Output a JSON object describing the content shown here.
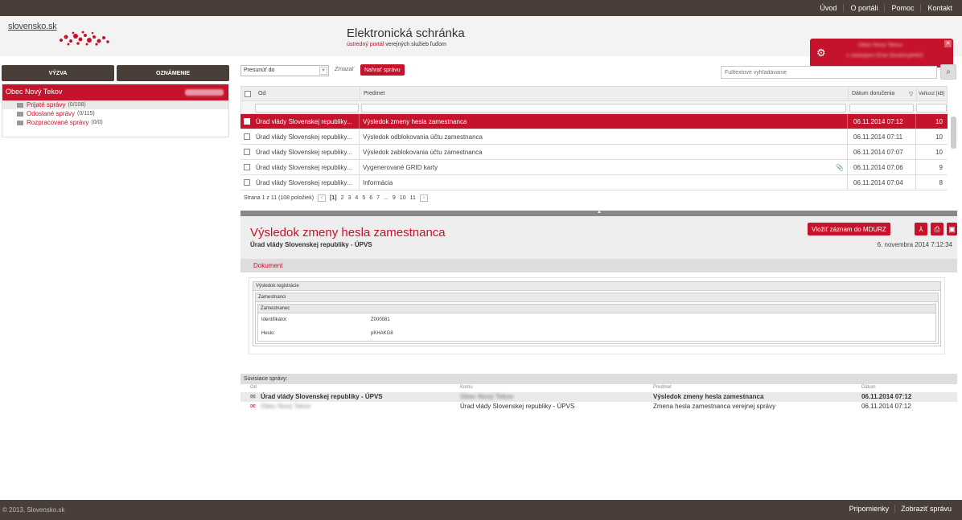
{
  "topnav": [
    "Úvod",
    "O portáli",
    "Pomoc",
    "Kontakt"
  ],
  "header": {
    "logo": "slovensko.sk",
    "title": "Elektronická schránka",
    "subtitle_red": "ústredný portál",
    "subtitle_dark": "verejných služieb ľuďom",
    "user_line1": "Obec Nový Tekov",
    "user_line2": "v zastúpení Emil Skuteľný#402"
  },
  "left": {
    "tab_challenge": "VÝZVA",
    "tab_notice": "OZNÁMENIE",
    "account": "Obec Nový Tekov",
    "folders": [
      {
        "label": "Prijaté správy",
        "count": "(0/108)"
      },
      {
        "label": "Odoslané správy",
        "count": "(0/115)"
      },
      {
        "label": "Rozpracované správy",
        "count": "(0/0)"
      }
    ]
  },
  "toolbar": {
    "move_value": "Presunúť do",
    "delete_label": "Zmazať",
    "load_label": "Nahrať správu",
    "search_placeholder": "Fulltextové vyhľadávanie"
  },
  "grid": {
    "columns": {
      "from": "Od",
      "subject": "Predmet",
      "date": "Dátum doručenia",
      "size": "Veľkosť [kB]"
    },
    "rows": [
      {
        "from": "Úrad vlády Slovenskej republiky...",
        "subject": "Výsledok zmeny hesla zamestnanca",
        "date": "06.11.2014 07:12",
        "size": "10"
      },
      {
        "from": "Úrad vlády Slovenskej republiky...",
        "subject": "Výsledok odblokovania účtu zamestnanca",
        "date": "06.11.2014 07:11",
        "size": "10"
      },
      {
        "from": "Úrad vlády Slovenskej republiky...",
        "subject": "Výsledok zablokovania účtu zamestnanca",
        "date": "06.11.2014 07:07",
        "size": "10"
      },
      {
        "from": "Úrad vlády Slovenskej republiky...",
        "subject": "Vygenerované GRID karty",
        "date": "06.11.2014 07:06",
        "size": "9"
      },
      {
        "from": "Úrad vlády Slovenskej republiky...",
        "subject": "Informácia",
        "date": "06.11.2014 07:04",
        "size": "8"
      }
    ]
  },
  "pager": {
    "summary": "Strana 1 z 11 (108 položiek)",
    "pages": [
      "[1]",
      "2",
      "3",
      "4",
      "5",
      "6",
      "7",
      "...",
      "9",
      "10",
      "11"
    ]
  },
  "detail": {
    "title": "Výsledok zmeny hesla zamestnanca",
    "from": "Úrad vlády Slovenskej republiky - ÚPVS",
    "date": "6. novembra 2014 7:12:34",
    "mdurz_label": "Vložiť záznam do MDURZ",
    "tab": "Dokument",
    "doc": {
      "section1": "Výsledok registrácie",
      "section2": "Zamestnanci",
      "section3": "Zamestnanec",
      "id_label": "Identifikátor:",
      "id_value": "Z000081",
      "pwd_label": "Heslo:",
      "pwd_value": "pKHAKG8"
    }
  },
  "related": {
    "title": "Súvisiace správy:",
    "cols": {
      "from": "Od",
      "to": "Komu",
      "subject": "Predmet",
      "date": "Dátum"
    },
    "rows": [
      {
        "from": "Úrad vlády Slovenskej republiky - ÚPVS",
        "to": "Obec Nový Tekov",
        "subject": "Výsledok zmeny hesla zamestnanca",
        "date": "06.11.2014 07:12"
      },
      {
        "from": "Obec Nový Tekov",
        "to": "Úrad vlády Slovenskej republiky - ÚPVS",
        "subject": "Zmena hesla zamestnanca verejnej správy",
        "date": "06.11.2014 07:12"
      }
    ]
  },
  "footer": {
    "copyright": "© 2013, Slovensko.sk",
    "link1": "Pripomienky",
    "link2": "Zobraziť správu"
  },
  "colors": {
    "brand_red": "#c4132a",
    "dark_bar": "#4a3f38"
  }
}
